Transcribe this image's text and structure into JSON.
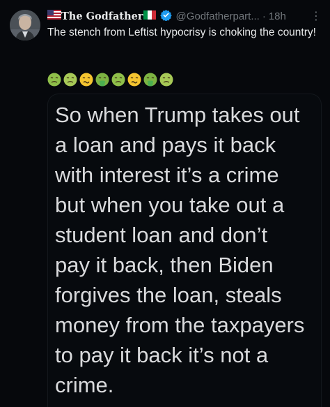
{
  "author": {
    "name": "The Godfather",
    "handle": "@Godfatherpart...",
    "separator": "·",
    "time": "18h",
    "verified_color": "#1d9bf0"
  },
  "tweet": {
    "text": "The stench from Leftist hypocrisy is choking the country!",
    "emojis": [
      "nauseated-face",
      "sick-face",
      "woozy-face",
      "vomiting-face",
      "nauseated-face",
      "woozy-face",
      "vomiting-face",
      "sick-face"
    ]
  },
  "media": {
    "text": "So when Trump takes out\na loan and pays it back\nwith interest it’s a crime\nbut when you take out a\nstudent loan and don’t\npay it back, then Biden\nforgives the loan, steals\nmoney from the taxpayers\nto pay it back it’s not a\ncrime."
  },
  "menu": {
    "more_label": "⋮"
  }
}
